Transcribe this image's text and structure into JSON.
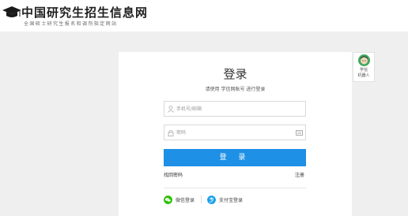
{
  "header": {
    "site_title": "中国研究生招生信息网",
    "site_subtitle": "全国硕士研究生报名和调剂指定网站"
  },
  "login": {
    "title": "登录",
    "hint": "请使用 学信网账号 进行登录",
    "phone_placeholder": "手机号/邮箱",
    "password_placeholder": "密码",
    "submit_label": "登 录",
    "forgot_label": "找回密码",
    "register_label": "注册",
    "wechat_label": "微信登录",
    "alipay_label": "支付宝登录"
  },
  "robot": {
    "label_line1": "学信",
    "label_line2": "机器人"
  },
  "colors": {
    "primary": "#1e90e6",
    "background": "#efefef",
    "wechat": "#2dc100",
    "alipay": "#1aa1ec"
  }
}
